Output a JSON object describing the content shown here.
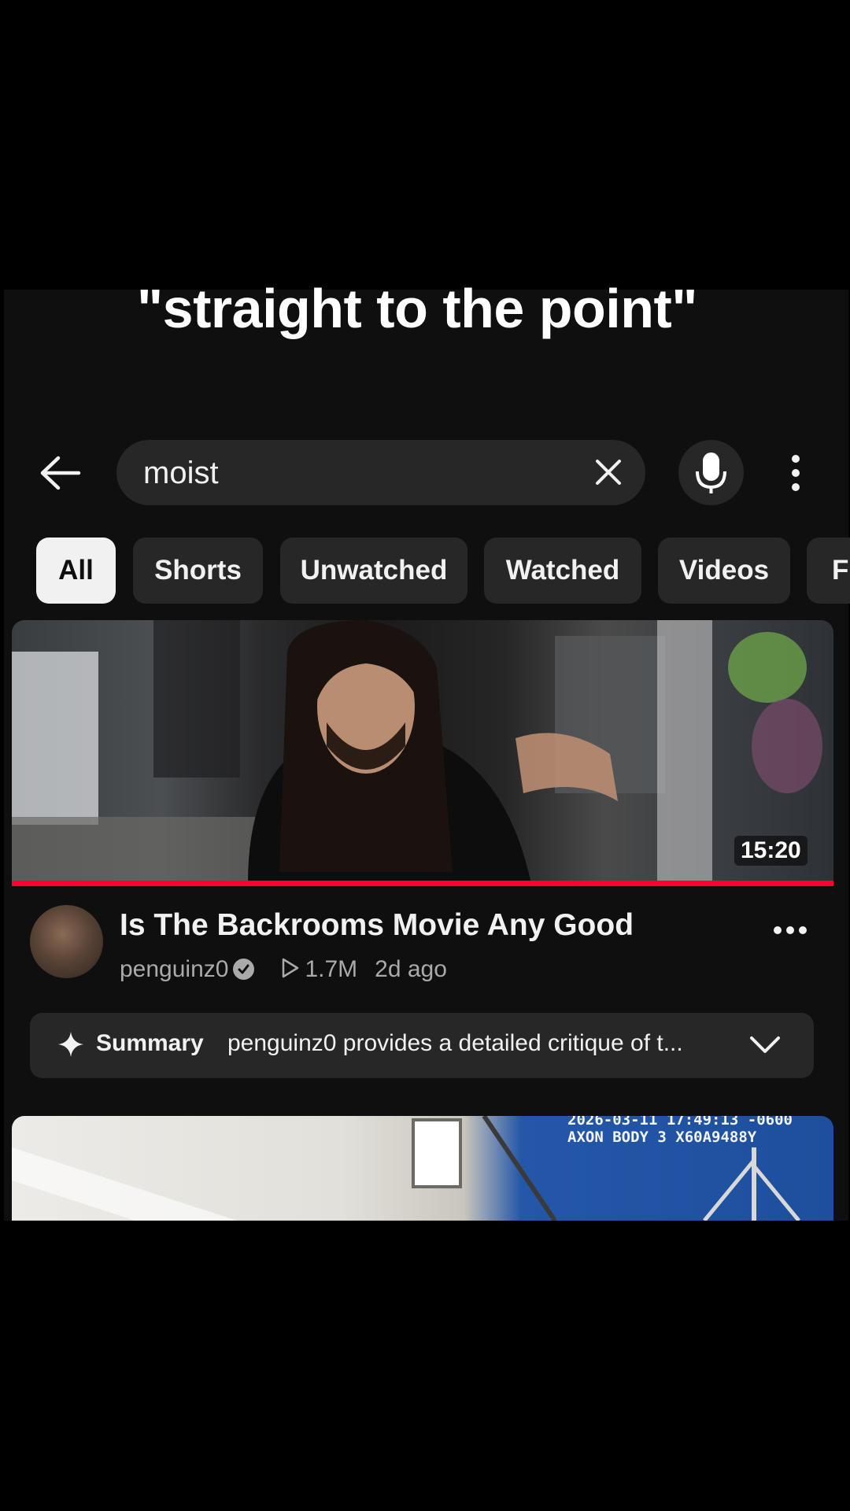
{
  "caption": "\"straight to the point\"",
  "search": {
    "query": "moist",
    "back_icon": "arrow-left-icon",
    "clear_icon": "close-icon",
    "mic_icon": "microphone-icon",
    "more_icon": "more-vert-icon"
  },
  "chips": [
    {
      "label": "All",
      "active": true
    },
    {
      "label": "Shorts",
      "active": false
    },
    {
      "label": "Unwatched",
      "active": false
    },
    {
      "label": "Watched",
      "active": false
    },
    {
      "label": "Videos",
      "active": false
    },
    {
      "label": "F",
      "active": false
    }
  ],
  "video": {
    "duration": "15:20",
    "watch_progress": 1.0,
    "title": "Is The Backrooms Movie Any Good",
    "channel": "penguinz0",
    "views": "1.7M",
    "age": "2d ago"
  },
  "summary": {
    "label": "Summary",
    "text": "penguinz0 provides a detailed critique of t..."
  },
  "next_video": {
    "overlay_line1": "2026-03-11 17:49:13 -0600",
    "overlay_line2": "AXON BODY 3 X60A9488Y"
  },
  "colors": {
    "background": "#0f0f0f",
    "chip": "#272727",
    "chip_active": "#f1f1f1",
    "progress": "#ff0033",
    "secondary_text": "#aaaaaa"
  }
}
